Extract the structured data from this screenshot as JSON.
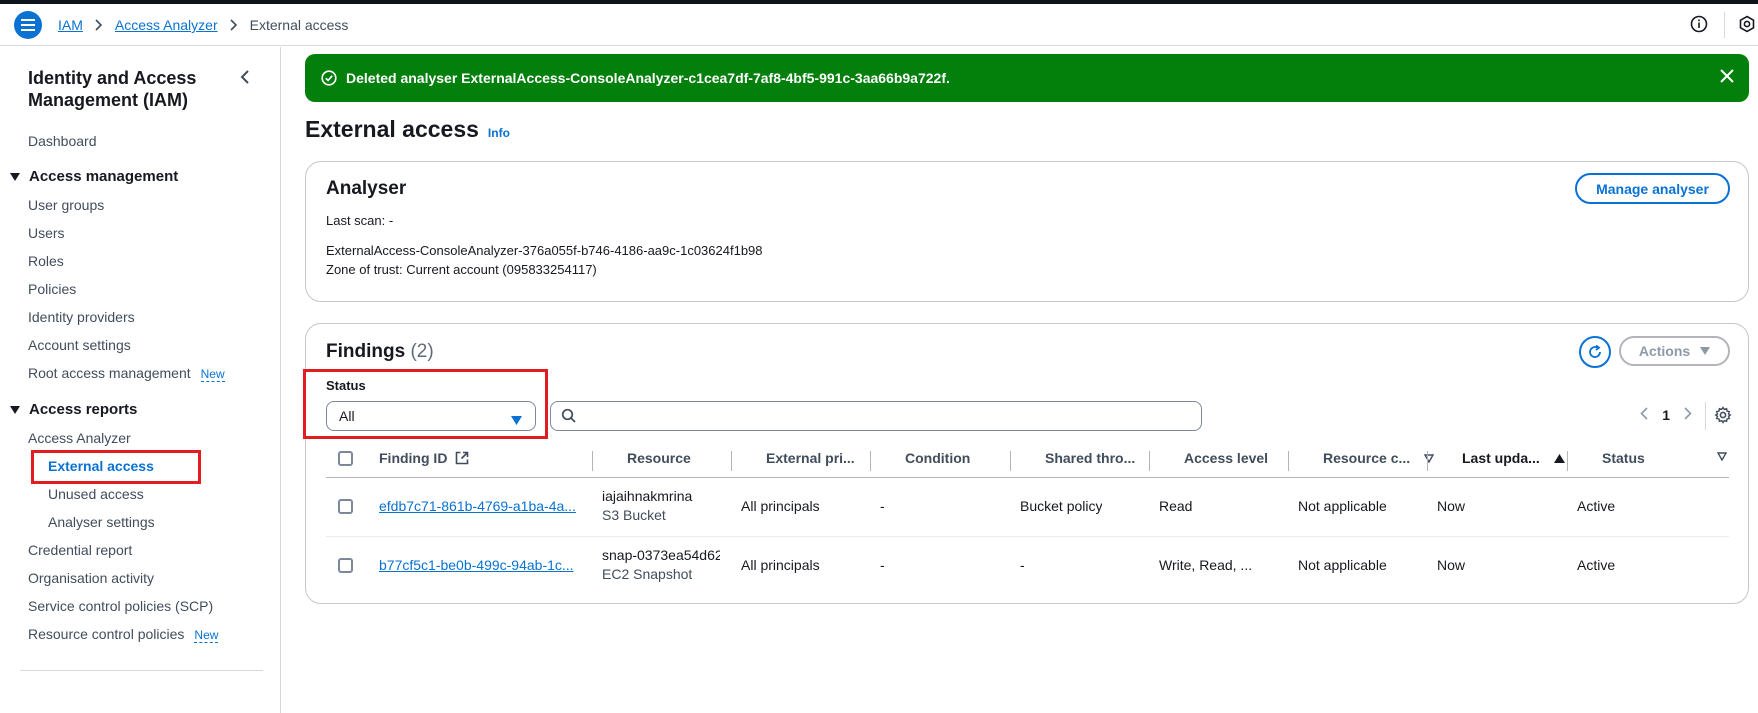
{
  "breadcrumb": {
    "items": [
      "IAM",
      "Access Analyzer"
    ],
    "current": "External access"
  },
  "sidebar": {
    "title": "Identity and Access Management (IAM)",
    "dashboard": "Dashboard",
    "access_management": {
      "label": "Access management",
      "items": [
        "User groups",
        "Users",
        "Roles",
        "Policies",
        "Identity providers",
        "Account settings",
        "Root access management"
      ],
      "new_badge": "New"
    },
    "access_reports": {
      "label": "Access reports",
      "access_analyzer": "Access Analyzer",
      "sub_items": [
        "External access",
        "Unused access",
        "Analyser settings"
      ],
      "items": [
        "Credential report",
        "Organisation activity",
        "Service control policies (SCP)",
        "Resource control policies"
      ],
      "new_badge": "New"
    }
  },
  "flash": {
    "message": "Deleted analyser ExternalAccess-ConsoleAnalyzer-c1cea7df-7af8-4bf5-991c-3aa66b9a722f.",
    "color": "#037f0c"
  },
  "page": {
    "title": "External access",
    "info": "Info"
  },
  "analyser": {
    "heading": "Analyser",
    "last_scan": "Last scan: -",
    "name": "ExternalAccess-ConsoleAnalyzer-376a055f-b746-4186-aa9c-1c03624f1b98",
    "zone": "Zone of trust: Current account (095833254117)",
    "manage_button": "Manage analyser"
  },
  "findings": {
    "heading": "Findings",
    "count": "(2)",
    "actions_button": "Actions",
    "status_label": "Status",
    "status_value": "All",
    "search_placeholder": "",
    "page_number": "1",
    "columns": [
      "Finding ID",
      "Resource",
      "External pri...",
      "Condition",
      "Shared thro...",
      "Access level",
      "Resource c...",
      "Last upda...",
      "Status"
    ],
    "rows": [
      {
        "finding_id": "efdb7c71-861b-4769-a1ba-4a...",
        "resource_name": "iajaihnakmrina",
        "resource_type": "S3 Bucket",
        "external_principal": "All principals",
        "condition": "-",
        "shared_through": "Bucket policy",
        "access_level": "Read",
        "resource_control": "Not applicable",
        "last_updated": "Now",
        "status": "Active"
      },
      {
        "finding_id": "b77cf5c1-be0b-499c-94ab-1c...",
        "resource_name": "snap-0373ea54d62",
        "resource_type": "EC2 Snapshot",
        "external_principal": "All principals",
        "condition": "-",
        "shared_through": "-",
        "access_level": "Write, Read, ...",
        "resource_control": "Not applicable",
        "last_updated": "Now",
        "status": "Active"
      }
    ]
  },
  "colors": {
    "link": "#0972d3",
    "highlight": "#e11d21"
  }
}
